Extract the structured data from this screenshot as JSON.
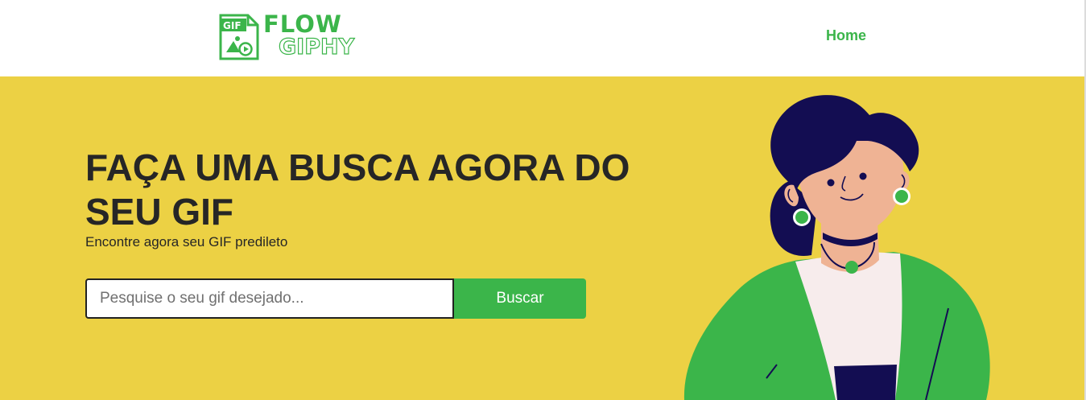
{
  "header": {
    "logo": {
      "icon_text": "GIF",
      "line1": "FLOW",
      "line2": "GIPHY"
    },
    "nav": {
      "home_label": "Home"
    }
  },
  "hero": {
    "title": "FAÇA UMA BUSCA AGORA DO SEU GIF",
    "subtitle": "Encontre agora seu GIF predileto",
    "search": {
      "placeholder": "Pesquise o seu gif desejado...",
      "value": "",
      "button_label": "Buscar"
    }
  },
  "colors": {
    "brand_green": "#3bb54a",
    "hero_background": "#ecd144",
    "text_dark": "#262626",
    "hair_navy": "#130d52",
    "skin": "#efb394"
  },
  "icons": [
    "gif-file-icon",
    "woman-illustration"
  ]
}
